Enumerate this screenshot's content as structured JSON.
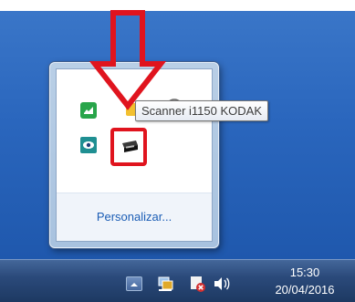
{
  "popup": {
    "customize_link": "Personalizar..."
  },
  "tooltip": {
    "text": "Scanner i1150 KODAK"
  },
  "taskbar": {
    "time": "15:30",
    "date": "20/04/2016"
  },
  "icons": {
    "tray_1": "green-app-icon",
    "tray_2": "yellow-app-icon",
    "tray_3": "user-app-icon",
    "tray_4": "eye-app-icon",
    "tray_5": "scanner-icon",
    "taskbar_1": "show-hidden-icons-icon",
    "taskbar_2": "network-icon",
    "taskbar_3": "action-center-icon",
    "taskbar_4": "volume-icon"
  },
  "colors": {
    "annotation_red": "#e0141e",
    "link_blue": "#1b5db5"
  }
}
